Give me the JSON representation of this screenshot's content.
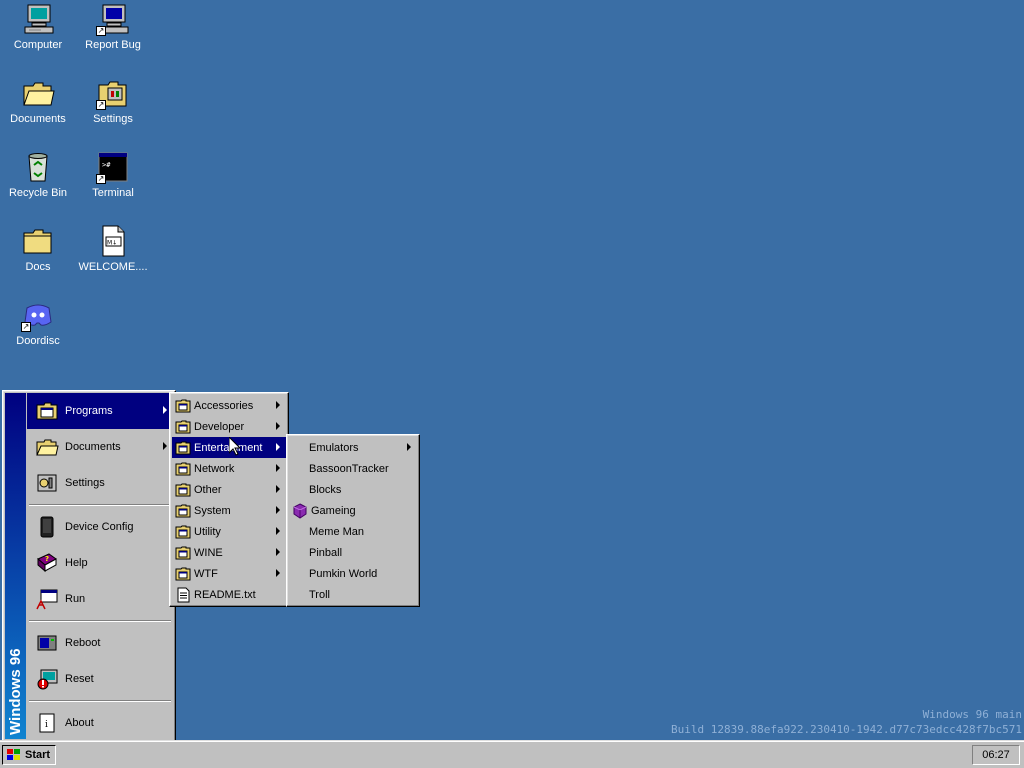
{
  "desktop": {
    "icons": [
      {
        "label": "Computer",
        "icon": "computer-icon"
      },
      {
        "label": "Report Bug",
        "icon": "computer-icon"
      },
      {
        "label": "Documents",
        "icon": "folder-open-icon"
      },
      {
        "label": "Settings",
        "icon": "settings-icon"
      },
      {
        "label": "Recycle Bin",
        "icon": "recycle-bin-icon"
      },
      {
        "label": "Terminal",
        "icon": "terminal-icon"
      },
      {
        "label": "Docs",
        "icon": "folder-icon"
      },
      {
        "label": "WELCOME....",
        "icon": "markdown-file-icon"
      },
      {
        "label": "Doordisc",
        "icon": "doordisc-icon"
      }
    ],
    "watermark_line1": "Windows 96 main",
    "watermark_line2": "Build 12839.88efa922.230410-1942.d77c73edcc428f7bc571"
  },
  "start_menu": {
    "brand": "Windows 96",
    "items": [
      {
        "label": "Programs",
        "icon": "programs-icon",
        "has_submenu": true
      },
      {
        "label": "Documents",
        "icon": "folder-open-icon",
        "has_submenu": true
      },
      {
        "label": "Settings",
        "icon": "settings-icon",
        "has_submenu": false
      },
      {
        "label": "Device Config",
        "icon": "device-icon",
        "has_submenu": false
      },
      {
        "label": "Help",
        "icon": "help-book-icon",
        "has_submenu": false
      },
      {
        "label": "Run",
        "icon": "run-icon",
        "has_submenu": false
      },
      {
        "label": "Reboot",
        "icon": "reboot-icon",
        "has_submenu": false
      },
      {
        "label": "Reset",
        "icon": "reset-icon",
        "has_submenu": false
      },
      {
        "label": "About",
        "icon": "about-icon",
        "has_submenu": false
      }
    ]
  },
  "programs_menu": {
    "items": [
      {
        "label": "Accessories",
        "icon": "program-folder-icon",
        "has_submenu": true
      },
      {
        "label": "Developer",
        "icon": "program-folder-icon",
        "has_submenu": true
      },
      {
        "label": "Entertainment",
        "icon": "program-folder-icon",
        "has_submenu": true
      },
      {
        "label": "Network",
        "icon": "program-folder-icon",
        "has_submenu": true
      },
      {
        "label": "Other",
        "icon": "program-folder-icon",
        "has_submenu": true
      },
      {
        "label": "System",
        "icon": "program-folder-icon",
        "has_submenu": true
      },
      {
        "label": "Utility",
        "icon": "program-folder-icon",
        "has_submenu": true
      },
      {
        "label": "WINE",
        "icon": "program-folder-icon",
        "has_submenu": true
      },
      {
        "label": "WTF",
        "icon": "program-folder-icon",
        "has_submenu": true
      },
      {
        "label": "README.txt",
        "icon": "text-file-icon",
        "has_submenu": false
      }
    ]
  },
  "entertainment_menu": {
    "items": [
      {
        "label": "Emulators",
        "has_submenu": true
      },
      {
        "label": "BassoonTracker",
        "has_submenu": false
      },
      {
        "label": "Blocks",
        "has_submenu": false
      },
      {
        "label": "Gameing",
        "has_submenu": false,
        "icon": "gameing-icon"
      },
      {
        "label": "Meme Man",
        "has_submenu": false
      },
      {
        "label": "Pinball",
        "has_submenu": false
      },
      {
        "label": "Pumkin World",
        "has_submenu": false
      },
      {
        "label": "Troll",
        "has_submenu": false
      }
    ]
  },
  "taskbar": {
    "start_label": "Start",
    "clock": "06:27"
  },
  "colors": {
    "desktop": "#3a6ea5",
    "highlight": "#000080",
    "face": "#c0c0c0"
  }
}
